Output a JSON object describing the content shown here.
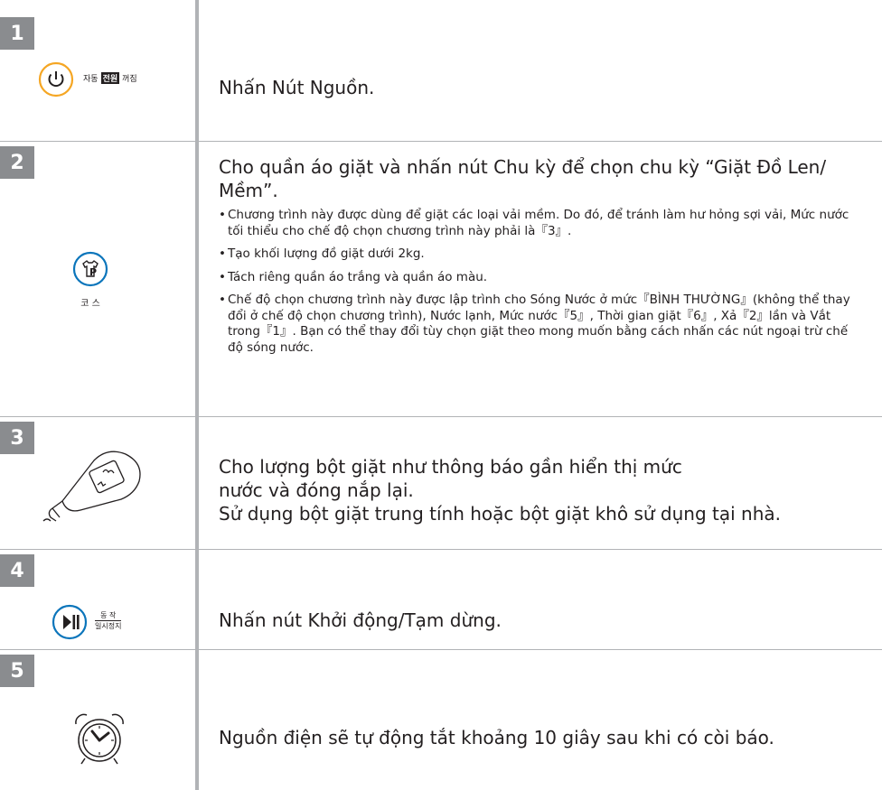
{
  "steps": [
    {
      "number": "1",
      "text": "Nhấn Nút Nguồn."
    },
    {
      "number": "2",
      "text": "Cho quần áo giặt và nhấn nút Chu kỳ để chọn chu kỳ “Giặt Đồ Len/ Mềm”.",
      "bullets": [
        "Chương trình này được dùng để giặt các loại vải mềm. Do đó, để tránh làm hư hỏng sợi vải, Mức nước tối thiểu cho chế độ chọn chương trình này phải là『3』.",
        "Tạo khối lượng đồ giặt dưới 2kg.",
        "Tách riêng quần áo trắng và quần áo màu.",
        "Chế độ chọn chương trình này được lập trình cho Sóng Nước ở mức『BÌNH THƯỜNG』(không thể thay đổi ở chế độ chọn chương trình), Nước lạnh, Mức nước『5』, Thời gian giặt『6』, Xả『2』lần và Vắt trong『1』. Bạn có thể thay đổi tùy chọn giặt theo mong muốn bằng cách nhấn các nút ngoại trừ chế độ sóng nước."
      ]
    },
    {
      "number": "3",
      "text_line1": "Cho lượng bột giặt như thông báo gần hiển thị mức nước và đóng nắp lại.",
      "text_line2": "Sử dụng bột giặt trung tính hoặc bột giặt khô sử dụng tại nhà."
    },
    {
      "number": "4",
      "text": "Nhấn nút Khởi động/Tạm dừng."
    },
    {
      "number": "5",
      "text": "Nguồn điện sẽ tự động tắt khoảng 10 giây sau khi có còi báo."
    }
  ],
  "icons": {
    "power": {
      "name": "power-icon",
      "left": "자동",
      "badge": "전원",
      "right": "꺼짐",
      "ring_color": "#f5a623"
    },
    "course": {
      "name": "course-icon",
      "label": "코 스",
      "ring_color": "#0b75bb"
    },
    "detergent": {
      "name": "detergent-bottle-icon"
    },
    "start": {
      "name": "play-pause-icon",
      "top": "동 작",
      "bottom": "일시정지",
      "ring_color": "#0b75bb"
    },
    "clock": {
      "name": "alarm-clock-icon"
    }
  },
  "colors": {
    "step_badge": "#8a8c8f",
    "divider": "#b1b3b6",
    "text": "#231f20"
  }
}
